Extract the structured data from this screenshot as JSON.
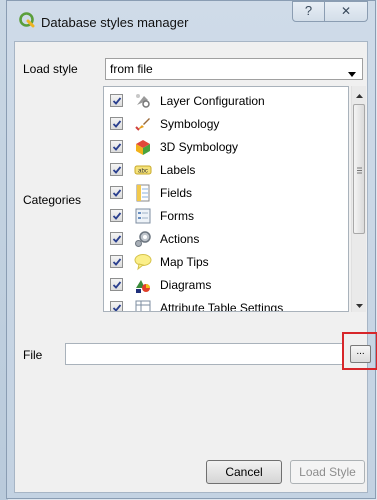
{
  "window": {
    "title": "Database styles manager",
    "help_glyph": "?",
    "close_glyph": "✕"
  },
  "load_style": {
    "label": "Load style",
    "value": "from file"
  },
  "categories": {
    "label": "Categories",
    "items": [
      {
        "label": "Layer Configuration",
        "checked": true,
        "icon": "layer-configuration-icon"
      },
      {
        "label": "Symbology",
        "checked": true,
        "icon": "symbology-brush-icon"
      },
      {
        "label": "3D Symbology",
        "checked": true,
        "icon": "3d-cube-icon"
      },
      {
        "label": "Labels",
        "checked": true,
        "icon": "labels-abc-icon"
      },
      {
        "label": "Fields",
        "checked": true,
        "icon": "fields-icon"
      },
      {
        "label": "Forms",
        "checked": true,
        "icon": "forms-icon"
      },
      {
        "label": "Actions",
        "checked": true,
        "icon": "actions-gear-icon"
      },
      {
        "label": "Map Tips",
        "checked": true,
        "icon": "map-tips-bubble-icon"
      },
      {
        "label": "Diagrams",
        "checked": true,
        "icon": "diagrams-icon"
      },
      {
        "label": "Attribute Table Settings",
        "checked": true,
        "icon": "attribute-table-icon"
      }
    ]
  },
  "file": {
    "label": "File",
    "value": "",
    "browse_label": "..."
  },
  "buttons": {
    "cancel": "Cancel",
    "load_style": "Load Style"
  },
  "colors": {
    "highlight_box": "#d7262a",
    "qgis_green": "#5a9e3a"
  }
}
